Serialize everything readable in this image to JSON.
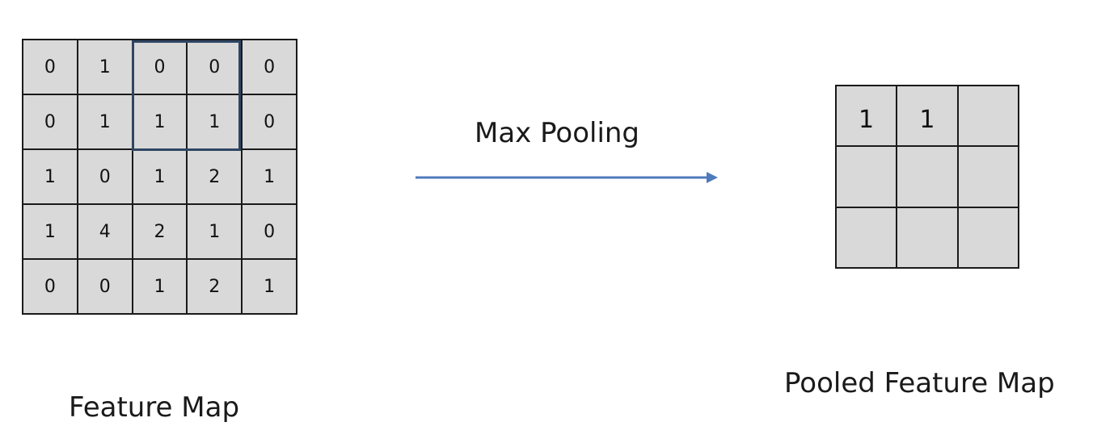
{
  "feature_map": {
    "label": "Feature Map",
    "rows": [
      [
        "0",
        "1",
        "0",
        "0",
        "0"
      ],
      [
        "0",
        "1",
        "1",
        "1",
        "0"
      ],
      [
        "1",
        "0",
        "1",
        "2",
        "1"
      ],
      [
        "1",
        "4",
        "2",
        "1",
        "0"
      ],
      [
        "0",
        "0",
        "1",
        "2",
        "1"
      ]
    ],
    "pooling_window": {
      "rows": [
        0,
        1
      ],
      "cols": [
        2,
        3
      ]
    }
  },
  "operation": {
    "label": "Max Pooling"
  },
  "pooled_map": {
    "label": "Pooled Feature Map",
    "rows": [
      [
        "1",
        "1",
        ""
      ],
      [
        "",
        "",
        ""
      ],
      [
        "",
        "",
        ""
      ]
    ]
  },
  "colors": {
    "cell_fill": "#d9d9d9",
    "grid_line": "#1a1a1a",
    "window_border": "#2f4563",
    "arrow": "#4f7bbd"
  }
}
